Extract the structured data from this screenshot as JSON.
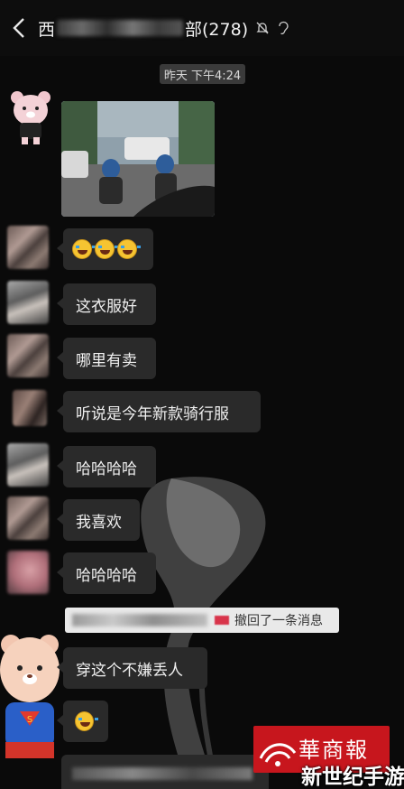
{
  "header": {
    "title_prefix": "西",
    "title_suffix": "部(278)",
    "mute_icon": "bell-off-icon",
    "ear_icon": "ear-icon"
  },
  "time_divider": "昨天 下午4:24",
  "messages": [
    {
      "type": "image",
      "desc_icon": "photo-icon"
    },
    {
      "type": "emoji",
      "count": 3
    },
    {
      "type": "text",
      "text": "这衣服好"
    },
    {
      "type": "text",
      "text": "哪里有卖"
    },
    {
      "type": "text",
      "text": "听说是今年新款骑行服"
    },
    {
      "type": "text",
      "text": "哈哈哈哈"
    },
    {
      "type": "text",
      "text": "我喜欢"
    },
    {
      "type": "text",
      "text": "哈哈哈哈"
    },
    {
      "type": "text",
      "text": "穿这个不嫌丢人"
    },
    {
      "type": "emoji",
      "count": 1
    }
  ],
  "recall_notice": "撤回了一条消息",
  "watermark_brand": "華商報",
  "watermark_site": "新世纪手游",
  "colors": {
    "background": "#0a0a0a",
    "bubble": "#2a2a2a",
    "brand_red": "#c7161d"
  }
}
